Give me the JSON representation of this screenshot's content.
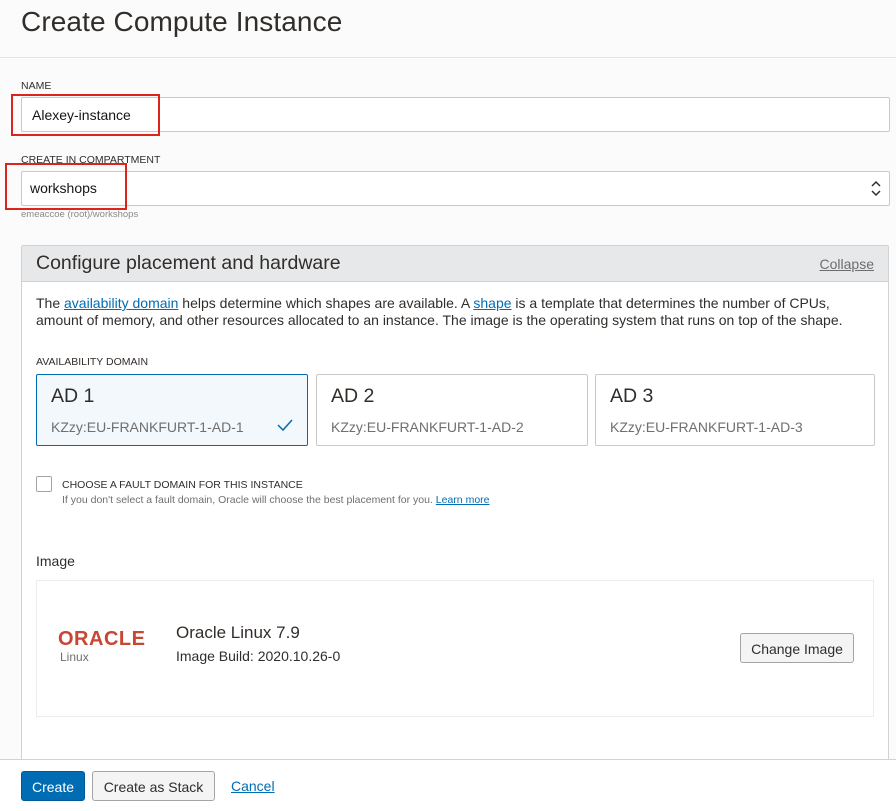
{
  "page": {
    "title": "Create Compute Instance"
  },
  "name_field": {
    "label": "NAME",
    "value": "Alexey-instance"
  },
  "compartment_field": {
    "label": "CREATE IN COMPARTMENT",
    "value": "workshops",
    "hint": "emeaccoe (root)/workshops"
  },
  "placement": {
    "title": "Configure placement and hardware",
    "collapse_label": "Collapse",
    "desc_1": "The ",
    "desc_link_1": "availability domain",
    "desc_2": " helps determine which shapes are available. A ",
    "desc_link_2": "shape",
    "desc_3": " is a template that determines the number of CPUs, amount of memory, and other resources allocated to an instance. The image is the operating system that runs on top of the shape.",
    "ad_label": "AVAILABILITY DOMAIN",
    "ads": [
      {
        "name": "AD 1",
        "id": "KZzy:EU-FRANKFURT-1-AD-1",
        "selected": true
      },
      {
        "name": "AD 2",
        "id": "KZzy:EU-FRANKFURT-1-AD-2",
        "selected": false
      },
      {
        "name": "AD 3",
        "id": "KZzy:EU-FRANKFURT-1-AD-3",
        "selected": false
      }
    ],
    "fault_domain_label": "CHOOSE A FAULT DOMAIN FOR THIS INSTANCE",
    "fault_domain_hint": "If you don't select a fault domain, Oracle will choose the best placement for you.",
    "fault_domain_link": "Learn more",
    "fault_domain_checked": false
  },
  "image": {
    "section_label": "Image",
    "logo_text": "ORACLE",
    "logo_subtext": "Linux",
    "name": "Oracle Linux 7.9",
    "build": "Image Build: 2020.10.26-0",
    "change_button": "Change Image"
  },
  "footer": {
    "create_label": "Create",
    "stack_label": "Create as Stack",
    "cancel_label": "Cancel"
  },
  "colors": {
    "accent": "#006cb4",
    "highlight_box": "#d9251c",
    "oracle_red": "#c74634"
  },
  "icons": {
    "select_arrow": "chevron-up-down-icon",
    "selected_check": "check-icon"
  }
}
